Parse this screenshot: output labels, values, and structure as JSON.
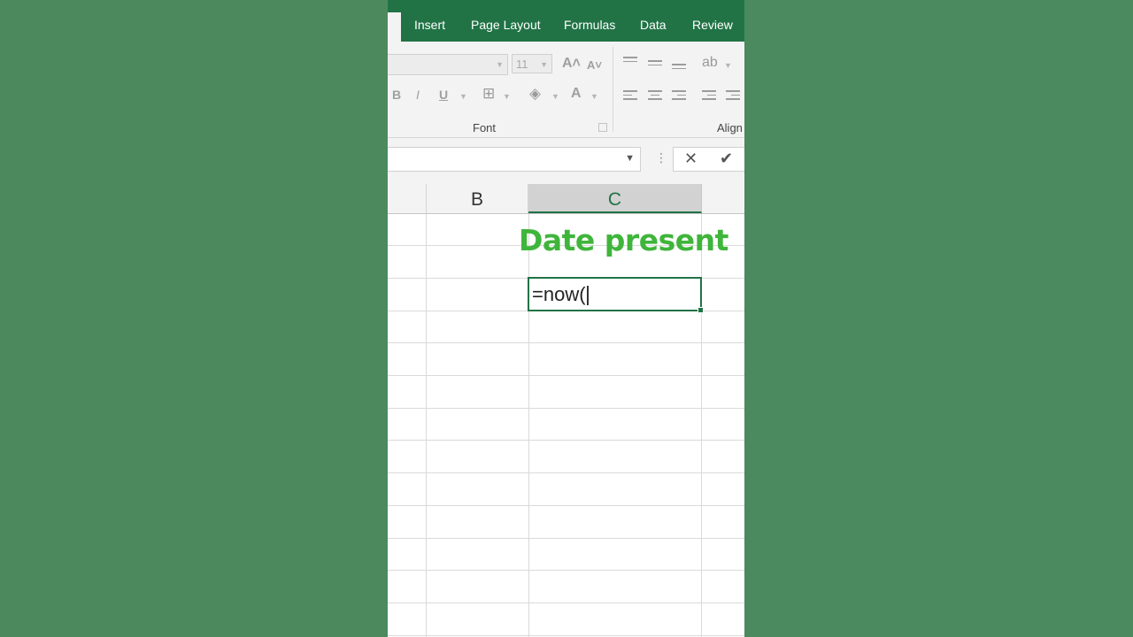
{
  "ribbon": {
    "tabs": [
      "Insert",
      "Page Layout",
      "Formulas",
      "Data",
      "Review"
    ],
    "font_size": "11",
    "font_group_label": "Font",
    "align_group_label": "Align"
  },
  "grid": {
    "columns": [
      "B",
      "C"
    ],
    "selected_column": "C",
    "heading_text": "Date present",
    "active_cell_formula": "=now("
  },
  "colors": {
    "ribbon_green": "#217346",
    "heading_green": "#3fb53b",
    "background_green": "#4a8a5e"
  },
  "icons": {
    "grow_font": "A˄",
    "shrink_font": "A˅",
    "bold": "B",
    "italic": "I",
    "underline": "U",
    "cancel": "✕",
    "enter": "✔"
  }
}
